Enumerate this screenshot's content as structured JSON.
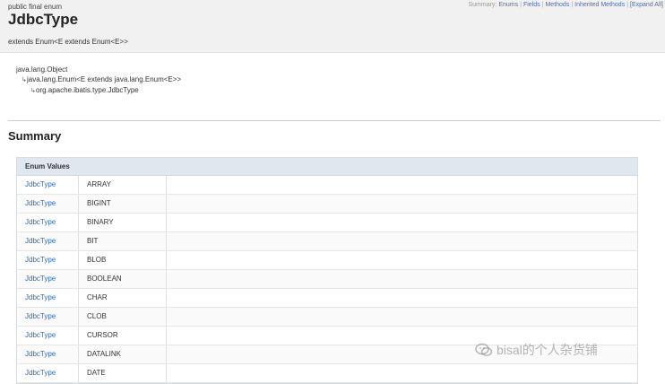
{
  "header": {
    "modifiers": "public final enum",
    "class_name": "JdbcType",
    "extends_text": "extends Enum<E extends Enum<E>>",
    "subnav": {
      "label": "Summary:",
      "links": [
        "Enums",
        "Fields",
        "Methods",
        "Inherited Methods",
        "[Expand All]"
      ]
    }
  },
  "inheritance": [
    "java.lang.Object",
    "java.lang.Enum<E extends java.lang.Enum<E>>",
    "org.apache.ibatis.type.JdbcType"
  ],
  "summary_title": "Summary",
  "enum_table": {
    "header": "Enum Values",
    "rows": [
      {
        "type": "JdbcType",
        "name": "ARRAY"
      },
      {
        "type": "JdbcType",
        "name": "BIGINT"
      },
      {
        "type": "JdbcType",
        "name": "BINARY"
      },
      {
        "type": "JdbcType",
        "name": "BIT"
      },
      {
        "type": "JdbcType",
        "name": "BLOB"
      },
      {
        "type": "JdbcType",
        "name": "BOOLEAN"
      },
      {
        "type": "JdbcType",
        "name": "CHAR"
      },
      {
        "type": "JdbcType",
        "name": "CLOB"
      },
      {
        "type": "JdbcType",
        "name": "CURSOR"
      },
      {
        "type": "JdbcType",
        "name": "DATALINK"
      },
      {
        "type": "JdbcType",
        "name": "DATE"
      }
    ]
  },
  "watermark": {
    "text": "bisal的个人杂货铺",
    "icon": "wechat-icon"
  },
  "colors": {
    "link": "#2f6bb5",
    "header_bg": "#f1f1f1",
    "table_header_bg": "#dfe8ef"
  }
}
